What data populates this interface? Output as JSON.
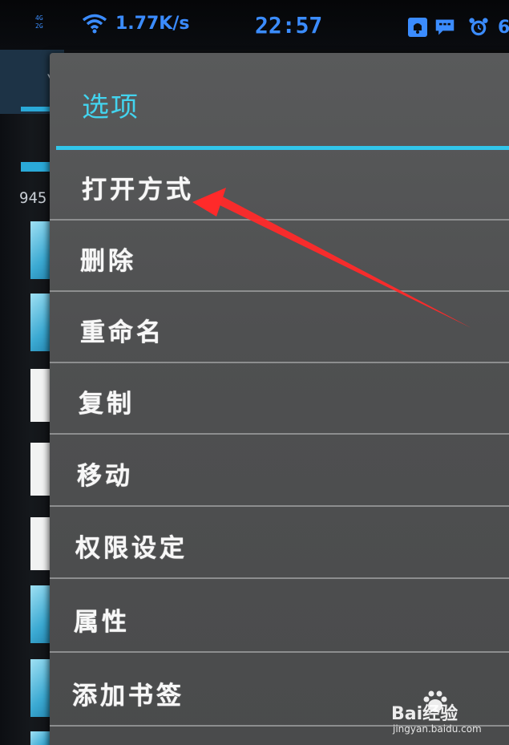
{
  "status_bar": {
    "signal_line1": "4G",
    "signal_line2": "2G",
    "net_speed": "1.77K/s",
    "time": "22:57",
    "battery_level": "6",
    "accent_color": "#3b8cff"
  },
  "background_app": {
    "file_size_text": "945."
  },
  "dialog": {
    "title": "选项",
    "accent_color": "#32c6ea",
    "items": [
      {
        "label": "打开方式"
      },
      {
        "label": "删除"
      },
      {
        "label": "重命名"
      },
      {
        "label": "复制"
      },
      {
        "label": "移动"
      },
      {
        "label": "权限设定"
      },
      {
        "label": "属性"
      },
      {
        "label": "添加书签"
      }
    ]
  },
  "annotation": {
    "arrow_color": "#ff2a2a",
    "points_to": "打开方式"
  },
  "watermark": {
    "brand": "Bai经验",
    "url": "jingyan.baidu.com"
  }
}
